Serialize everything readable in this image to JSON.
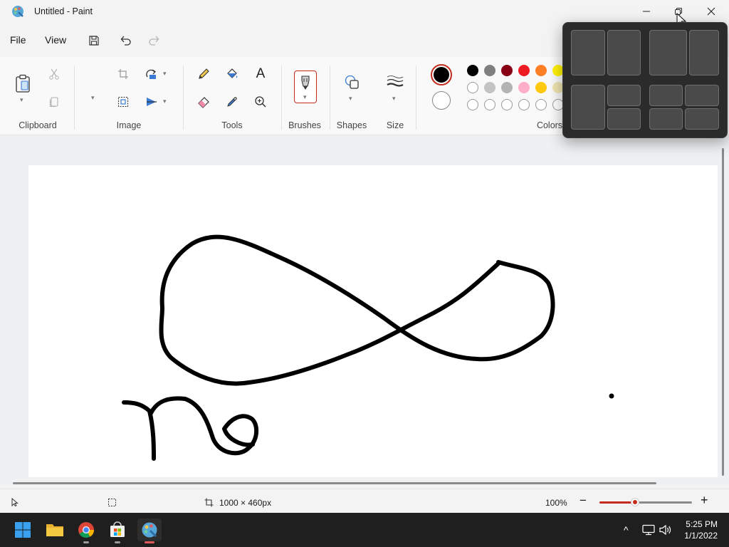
{
  "window": {
    "title": "Untitled - Paint",
    "minimize_glyph": "—",
    "close_glyph": "✕"
  },
  "menu": {
    "file": "File",
    "view": "View"
  },
  "ribbon": {
    "groups": {
      "clipboard": "Clipboard",
      "image": "Image",
      "tools": "Tools",
      "brushes": "Brushes",
      "shapes": "Shapes",
      "size": "Size",
      "colors": "Colors"
    },
    "text_tool_glyph": "A",
    "primary_color": "#000000",
    "secondary_color": "#ffffff"
  },
  "palette": {
    "row1": [
      "#000000",
      "#7f7f7f",
      "#880015",
      "#ed1c24",
      "#ff7f27",
      "#fff200"
    ],
    "row2": [
      "#ffffff",
      "#c3c3c3",
      "#b4b4b4",
      "#ffaec9",
      "#ffc90e",
      "#efe4b0"
    ],
    "row3": [
      "#ffffff",
      "#ffffff",
      "#ffffff",
      "#ffffff",
      "#ffffff",
      "#ffffff"
    ]
  },
  "status": {
    "canvas_size": "1000 × 460px",
    "zoom": "100%",
    "zoom_level_percent": 100,
    "zoom_out_glyph": "−",
    "zoom_in_glyph": "+"
  },
  "taskbar": {
    "time": "5:25 PM",
    "date": "1/1/2022",
    "overflow_glyph": "^",
    "apps": [
      "start-icon",
      "file-explorer-icon",
      "chrome-icon",
      "microsoft-store-icon",
      "paint-icon"
    ]
  },
  "colors": {
    "accent": "#c42b1c",
    "taskbar": "#1f1f1f",
    "snap_bg": "#2b2b2b"
  }
}
